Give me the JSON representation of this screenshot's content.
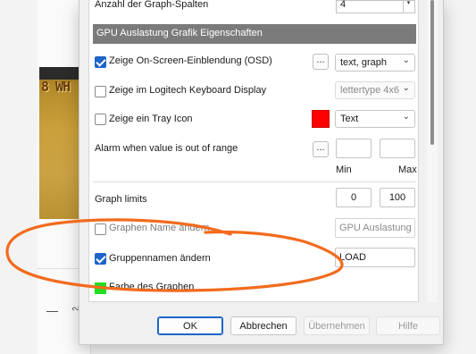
{
  "background_app": {
    "image_text": "8 WH"
  },
  "dialog": {
    "graph_columns": {
      "label": "Anzahl der Graph-Spalten",
      "value": "4"
    },
    "section_title": "GPU Auslastung Grafik Eigenschaften",
    "osd": {
      "label": "Zeige On-Screen-Einblendung (OSD)",
      "checked": true,
      "button": "...",
      "combo_value": "text, graph"
    },
    "logitech": {
      "label": "Zeige im Logitech Keyboard Display",
      "checked": false,
      "combo_value": "lettertype 4x6"
    },
    "tray": {
      "label": "Zeige ein Tray Icon",
      "checked": false,
      "swatch_color": "#ff0000",
      "combo_value": "Text"
    },
    "alarm": {
      "label": "Alarm when value is out of range",
      "button": "...",
      "min_value": "",
      "max_value": "",
      "min_label": "Min",
      "max_label": "Max"
    },
    "graph_limits": {
      "label": "Graph limits",
      "min": "0",
      "max": "100"
    },
    "graph_name": {
      "label": "Graphen Name ändern",
      "checked": false,
      "value": "GPU Auslastung"
    },
    "group_name": {
      "label": "Gruppennamen ändern",
      "checked": true,
      "value": "LOAD"
    },
    "graph_color": {
      "label": "Farbe des Graphen",
      "swatch_color": "#22dd22"
    },
    "buttons": {
      "ok": "OK",
      "cancel": "Abbrechen",
      "apply": "Übernehmen",
      "help": "Hilfe"
    }
  },
  "annotation": {
    "color": "#f26b1d",
    "shape": "hand-drawn ellipse"
  }
}
